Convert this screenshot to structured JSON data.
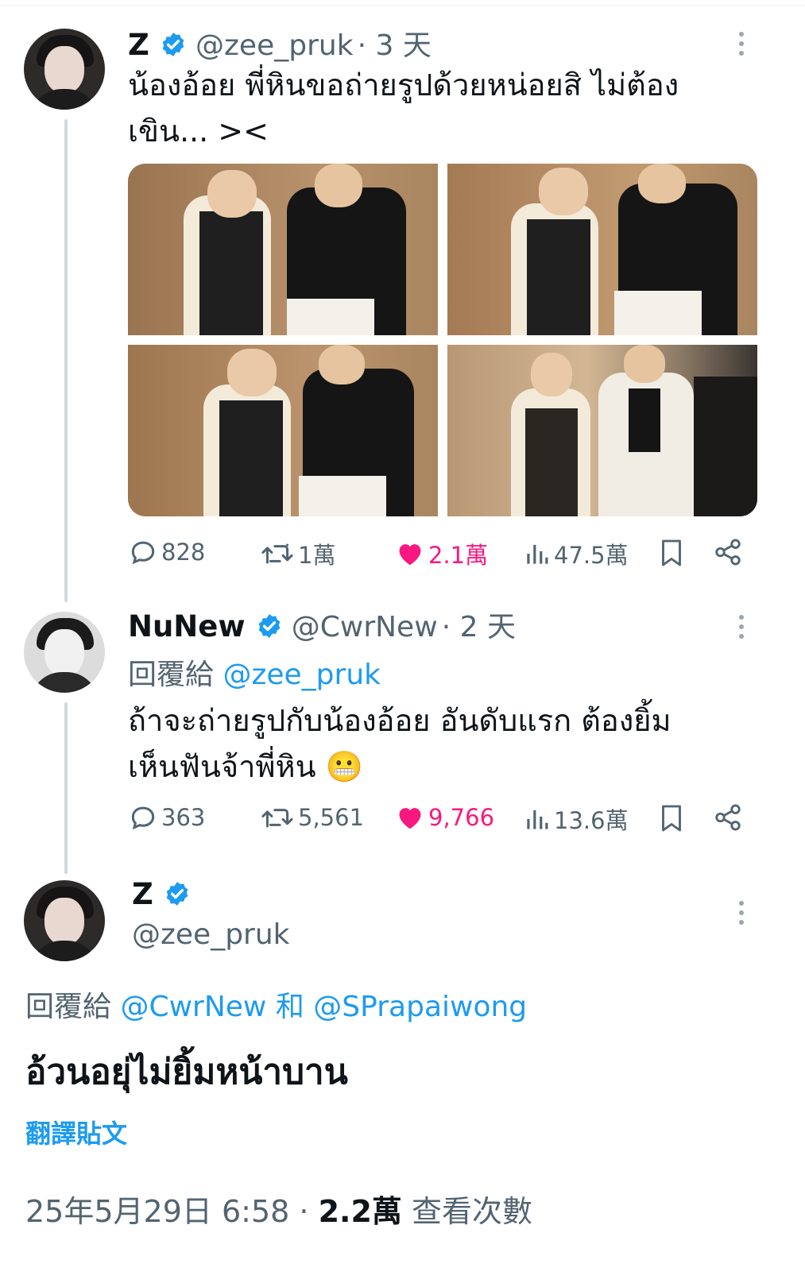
{
  "tweets": [
    {
      "name": "Z",
      "handle": "@zee_pruk",
      "time": "· 3 天",
      "text_line1": "น้องอ้อย พี่หินขอถ่ายรูปด้วยหน่อยสิ ไม่ต้อง",
      "text_line2": "เขิน... ><",
      "stats": {
        "replies": "828",
        "reposts": "1萬",
        "likes": "2.1萬",
        "views": "47.5萬"
      }
    },
    {
      "name": "NuNew",
      "handle": "@CwrNew",
      "time": "· 2 天",
      "reply_prefix": "回覆給",
      "reply_to": "@zee_pruk",
      "text_line1": "ถ้าจะถ่ายรูปกับน้องอ้อย อันดับแรก ต้องยิ้ม",
      "text_line2": "เห็นฟันจ้าพี่หิน",
      "emoji": "😬",
      "stats": {
        "replies": "363",
        "reposts": "5,561",
        "likes": "9,766",
        "views": "13.6萬"
      }
    }
  ],
  "main": {
    "name": "Z",
    "handle": "@zee_pruk",
    "reply_prefix": "回覆給",
    "reply_to_1": "@CwrNew",
    "reply_and": "和",
    "reply_to_2": "@SPrapaiwong",
    "text": "อ้วนอยุ่ไม่ยิ้มหน้าบาน",
    "translate": "翻譯貼文",
    "timestamp": "25年5月29日 6:58",
    "sep": "·",
    "views": "2.2萬",
    "views_label": "查看次數"
  },
  "colors": {
    "accent": "#1d9bf0",
    "like": "#f91880",
    "muted": "#536471"
  },
  "icons": [
    "verified-badge-icon",
    "more-dots-icon",
    "reply-icon",
    "repost-icon",
    "heart-icon",
    "views-icon",
    "bookmark-icon",
    "share-icon"
  ]
}
